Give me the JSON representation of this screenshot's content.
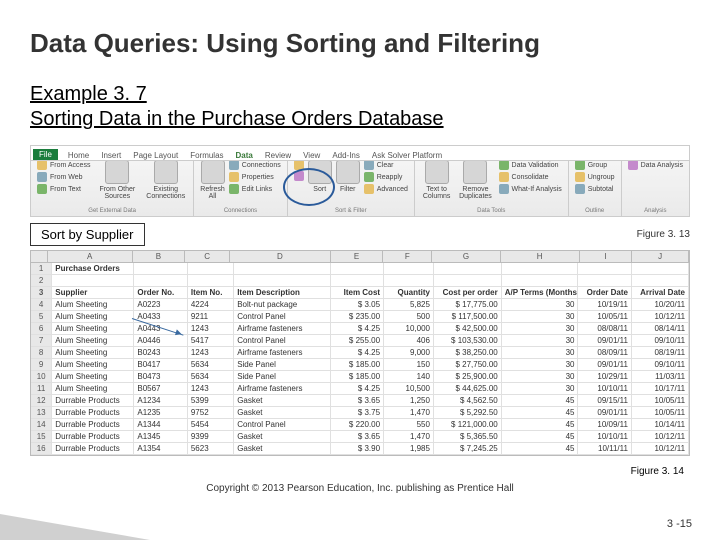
{
  "title": "Data Queries: Using Sorting and Filtering",
  "example_no": "Example 3. 7",
  "example_sub": "Sorting Data in the Purchase Orders Database",
  "ribbon": {
    "tabs": {
      "file": "File",
      "home": "Home",
      "insert": "Insert",
      "layout": "Page Layout",
      "formulas": "Formulas",
      "data": "Data",
      "review": "Review",
      "view": "View",
      "addins": "Add-Ins",
      "ask": "Ask Solver Platform"
    },
    "ext": {
      "access": "From Access",
      "web": "From Web",
      "text": "From Text",
      "other": "From Other Sources",
      "existing": "Existing Connections",
      "extlbl": "Get External Data"
    },
    "conn": {
      "refresh": "Refresh All",
      "conns": "Connections",
      "props": "Properties",
      "edit": "Edit Links",
      "lbl": "Connections"
    },
    "sort": {
      "sort": "Sort",
      "filter": "Filter",
      "clear": "Clear",
      "reapply": "Reapply",
      "adv": "Advanced",
      "lbl": "Sort & Filter"
    },
    "tools": {
      "ttc": "Text to Columns",
      "rmdup": "Remove Duplicates",
      "dv": "Data Validation",
      "cons": "Consolidate",
      "wia": "What-If Analysis",
      "lbl": "Data Tools"
    },
    "outline": {
      "grp": "Group",
      "ungrp": "Ungroup",
      "sub": "Subtotal",
      "lbl": "Outline"
    },
    "analysis": {
      "da": "Data Analysis",
      "lbl": "Analysis"
    }
  },
  "caption": {
    "sort_by": "Sort by Supplier",
    "fig13": "Figure 3. 13",
    "fig14": "Figure 3. 14"
  },
  "cols": [
    "",
    "A",
    "B",
    "C",
    "D",
    "E",
    "F",
    "G",
    "H",
    "I",
    "J"
  ],
  "header_row": {
    "a": "Purchase Orders"
  },
  "field_row": {
    "a": "Supplier",
    "b": "Order No.",
    "c": "Item No.",
    "d": "Item Description",
    "e": "Item Cost",
    "f": "Quantity",
    "g": "Cost per order",
    "h": "A/P Terms (Months)",
    "i": "Order Date",
    "j": "Arrival Date"
  },
  "rows": [
    {
      "n": "4",
      "a": "Alum Sheeting",
      "b": "A0223",
      "c": "4224",
      "d": "Bolt-nut package",
      "e": "$   3.05",
      "f": "5,825",
      "g": "$   17,775.00",
      "h": "30",
      "i": "10/19/11",
      "j": "10/20/11"
    },
    {
      "n": "5",
      "a": "Alum Sheeting",
      "b": "A0433",
      "c": "9211",
      "d": "Control Panel",
      "e": "$ 235.00",
      "f": "500",
      "g": "$ 117,500.00",
      "h": "30",
      "i": "10/05/11",
      "j": "10/12/11"
    },
    {
      "n": "6",
      "a": "Alum Sheeting",
      "b": "A0443",
      "c": "1243",
      "d": "Airframe fasteners",
      "e": "$   4.25",
      "f": "10,000",
      "g": "$   42,500.00",
      "h": "30",
      "i": "08/08/11",
      "j": "08/14/11"
    },
    {
      "n": "7",
      "a": "Alum Sheeting",
      "b": "A0446",
      "c": "5417",
      "d": "Control Panel",
      "e": "$ 255.00",
      "f": "406",
      "g": "$ 103,530.00",
      "h": "30",
      "i": "09/01/11",
      "j": "09/10/11"
    },
    {
      "n": "8",
      "a": "Alum Sheeting",
      "b": "B0243",
      "c": "1243",
      "d": "Airframe fasteners",
      "e": "$   4.25",
      "f": "9,000",
      "g": "$   38,250.00",
      "h": "30",
      "i": "08/09/11",
      "j": "08/19/11"
    },
    {
      "n": "9",
      "a": "Alum Sheeting",
      "b": "B0417",
      "c": "5634",
      "d": "Side Panel",
      "e": "$ 185.00",
      "f": "150",
      "g": "$   27,750.00",
      "h": "30",
      "i": "09/01/11",
      "j": "09/10/11"
    },
    {
      "n": "10",
      "a": "Alum Sheeting",
      "b": "B0473",
      "c": "5634",
      "d": "Side Panel",
      "e": "$ 185.00",
      "f": "140",
      "g": "$   25,900.00",
      "h": "30",
      "i": "10/29/11",
      "j": "11/03/11"
    },
    {
      "n": "11",
      "a": "Alum Sheeting",
      "b": "B0567",
      "c": "1243",
      "d": "Airframe fasteners",
      "e": "$   4.25",
      "f": "10,500",
      "g": "$   44,625.00",
      "h": "30",
      "i": "10/10/11",
      "j": "10/17/11"
    },
    {
      "n": "12",
      "a": "Durrable Products",
      "b": "A1234",
      "c": "5399",
      "d": "Gasket",
      "e": "$   3.65",
      "f": "1,250",
      "g": "$     4,562.50",
      "h": "45",
      "i": "09/15/11",
      "j": "10/05/11"
    },
    {
      "n": "13",
      "a": "Durrable Products",
      "b": "A1235",
      "c": "9752",
      "d": "Gasket",
      "e": "$   3.75",
      "f": "1,470",
      "g": "$     5,292.50",
      "h": "45",
      "i": "09/01/11",
      "j": "10/05/11"
    },
    {
      "n": "14",
      "a": "Durrable Products",
      "b": "A1344",
      "c": "5454",
      "d": "Control Panel",
      "e": "$ 220.00",
      "f": "550",
      "g": "$ 121,000.00",
      "h": "45",
      "i": "10/09/11",
      "j": "10/14/11"
    },
    {
      "n": "15",
      "a": "Durrable Products",
      "b": "A1345",
      "c": "9399",
      "d": "Gasket",
      "e": "$   3.65",
      "f": "1,470",
      "g": "$     5,365.50",
      "h": "45",
      "i": "10/10/11",
      "j": "10/12/11"
    },
    {
      "n": "16",
      "a": "Durrable Products",
      "b": "A1354",
      "c": "5623",
      "d": "Gasket",
      "e": "$   3.90",
      "f": "1,985",
      "g": "$     7,245.25",
      "h": "45",
      "i": "10/11/11",
      "j": "10/12/11"
    }
  ],
  "copyright": "Copyright © 2013 Pearson Education, Inc. publishing as Prentice Hall",
  "pagenum": "3 -15"
}
